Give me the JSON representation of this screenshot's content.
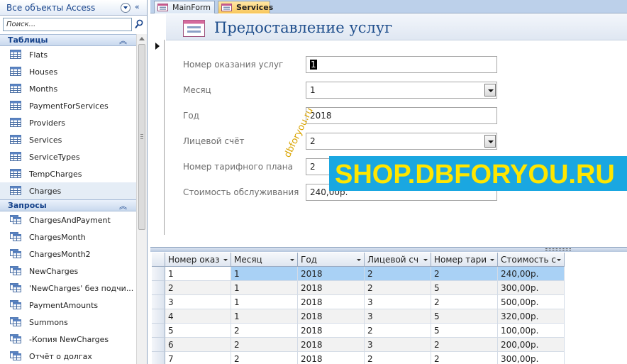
{
  "nav": {
    "title": "Все объекты Access",
    "collapse_glyph": "«",
    "search_placeholder": "Поиск...",
    "groups": [
      {
        "label": "Таблицы",
        "chevron": "︽",
        "items": [
          "Flats",
          "Houses",
          "Months",
          "PaymentForServices",
          "Providers",
          "Services",
          "ServiceTypes",
          "TempCharges",
          "Charges"
        ]
      },
      {
        "label": "Запросы",
        "chevron": "︽",
        "items": [
          "ChargesAndPayment",
          "ChargesMonth",
          "ChargesMonth2",
          "NewCharges",
          "'NewCharges' без подчи...",
          "PaymentAmounts",
          "Summons",
          "-Копия NewCharges",
          "Отчёт о долгах"
        ]
      }
    ]
  },
  "tabs": [
    {
      "label": "MainForm"
    },
    {
      "label": "Services"
    }
  ],
  "form": {
    "title": "Предоставление услуг",
    "fields": [
      {
        "label": "Номер оказания услуг",
        "value": "1",
        "dropdown": false
      },
      {
        "label": "Месяц",
        "value": "1",
        "dropdown": true
      },
      {
        "label": "Год",
        "value": "2018",
        "dropdown": false
      },
      {
        "label": "Лицевой счёт",
        "value": "2",
        "dropdown": true
      },
      {
        "label": "Номер тарифного плана",
        "value": "2",
        "dropdown": false
      },
      {
        "label": "Стоимость обслуживания",
        "value": "240,00р.",
        "dropdown": false
      }
    ]
  },
  "watermark": {
    "main": "SHOP.DBFORYOU.RU",
    "diagonal": "dbforyou.ru"
  },
  "datasheet": {
    "columns": [
      "Номер оказ",
      "Месяц",
      "Год",
      "Лицевой сч",
      "Номер тари",
      "Стоимость с"
    ],
    "rows": [
      [
        "1",
        "1",
        "2018",
        "2",
        "2",
        "240,00р."
      ],
      [
        "2",
        "1",
        "2018",
        "2",
        "5",
        "300,00р."
      ],
      [
        "3",
        "1",
        "2018",
        "3",
        "2",
        "500,00р."
      ],
      [
        "4",
        "1",
        "2018",
        "3",
        "5",
        "320,00р."
      ],
      [
        "5",
        "2",
        "2018",
        "2",
        "5",
        "100,00р."
      ],
      [
        "6",
        "2",
        "2018",
        "3",
        "2",
        "200,00р."
      ],
      [
        "7",
        "2",
        "2018",
        "2",
        "2",
        "300,00р."
      ]
    ]
  },
  "colors": {
    "tab_active": "#f8c65b",
    "header_text": "#15428b",
    "watermark_bg": "#1aa7e1",
    "watermark_text": "#ffe600",
    "selection": "#a9d1f5"
  }
}
